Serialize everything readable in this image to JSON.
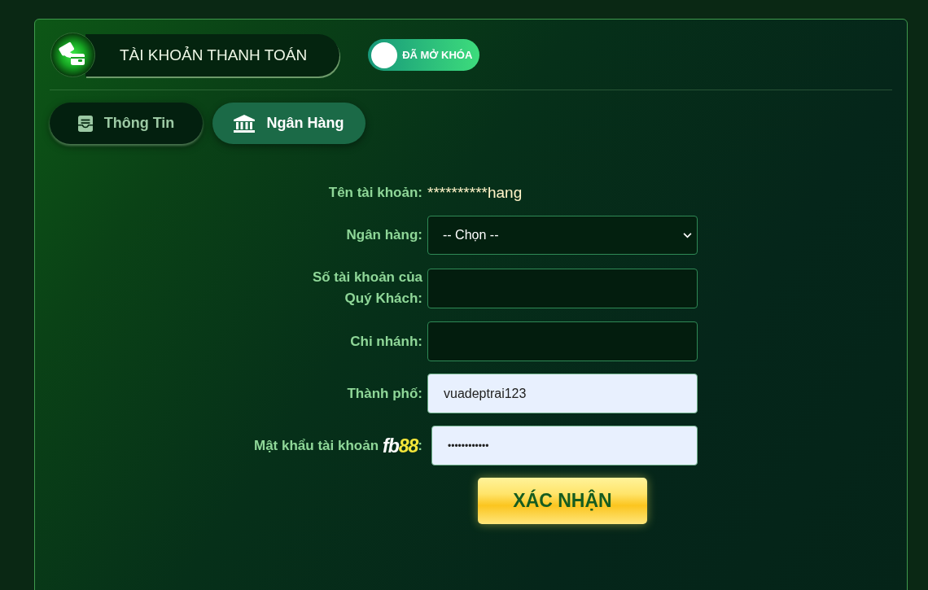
{
  "header": {
    "title": "TÀI KHOẢN THANH TOÁN",
    "lock_toggle": {
      "label": "ĐÃ MỞ KHÓA",
      "on": true
    }
  },
  "tabs": [
    {
      "label": "Thông Tin",
      "selected": false
    },
    {
      "label": "Ngân Hàng",
      "selected": true
    }
  ],
  "form": {
    "rows": [
      {
        "kind": "static",
        "label": "Tên tài khoản:",
        "value": "**********hang"
      },
      {
        "kind": "select",
        "label": "Ngân hàng:",
        "value": "-- Chọn --"
      },
      {
        "kind": "text",
        "label": "Số tài khoản của Quý Khách:",
        "autofilled": false
      },
      {
        "kind": "text",
        "label": "Chi nhánh:",
        "autofilled": false
      },
      {
        "kind": "text",
        "label": "Thành phố:",
        "value": "vuadeptrai123",
        "autofilled": true
      },
      {
        "kind": "password",
        "label": "Mật khẩu tài khoản",
        "logo": [
          "fb",
          "88"
        ],
        "label_end": ":",
        "value": "••••••••••••",
        "autofilled": true
      }
    ],
    "submit": "XÁC NHẬN"
  }
}
